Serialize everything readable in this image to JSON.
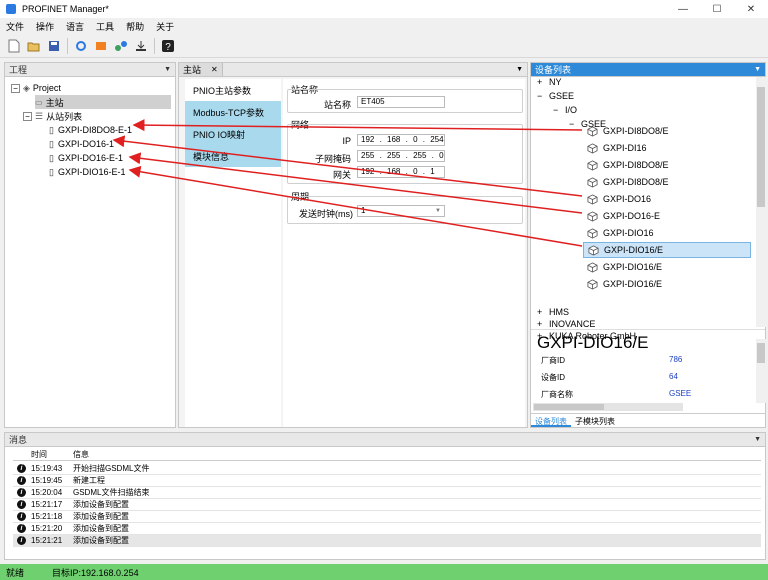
{
  "window": {
    "title": "PROFINET Manager*",
    "controls": [
      "—",
      "☐",
      "✕"
    ]
  },
  "menu": [
    "文件",
    "操作",
    "语言",
    "工具",
    "帮助",
    "关于"
  ],
  "project_panel": {
    "title": "工程",
    "root": "Project",
    "master": "主站",
    "slave_list": "从站列表",
    "slaves": [
      "GXPI-DI8DO8-E-1",
      "GXPI-DO16-1",
      "GXPI-DO16-E-1",
      "GXPI-DIO16-E-1"
    ]
  },
  "center_panel": {
    "tab_label": "主站",
    "side_tabs": [
      "PNIO主站参数",
      "Modbus-TCP参数",
      "PNIO IO映射",
      "模块信息"
    ],
    "station": {
      "group": "站名称",
      "label": "站名称",
      "value": "ET405"
    },
    "network": {
      "group": "网络",
      "ip_label": "IP",
      "ip": [
        "192",
        "168",
        "0",
        "254"
      ],
      "mask_label": "子网掩码",
      "mask": [
        "255",
        "255",
        "255",
        "0"
      ],
      "gw_label": "网关",
      "gw": [
        "192",
        "168",
        "0",
        "1"
      ]
    },
    "cycle": {
      "group": "周期",
      "label": "发送时钟(ms)",
      "value": "1"
    }
  },
  "device_panel": {
    "title": "设备列表",
    "vendors_top": [
      "NY",
      "GSEE"
    ],
    "io_label": "I/O",
    "gsee_label": "GSEE",
    "devices": [
      "GXPI-DI8DO8/E",
      "GXPI-DI16",
      "GXPI-DI8DO8/E",
      "GXPI-DI8DO8/E",
      "GXPI-DO16",
      "GXPI-DO16-E",
      "GXPI-DIO16",
      "GXPI-DIO16/E",
      "GXPI-DIO16/E",
      "GXPI-DIO16/E"
    ],
    "selected_index": 7,
    "vendors_bottom": [
      "HMS",
      "INOVANCE",
      "KUKA Roboter GmbH"
    ],
    "detail": {
      "name": "GXPI-DIO16/E",
      "rows": [
        {
          "label": "厂商ID",
          "value": "786"
        },
        {
          "label": "设备ID",
          "value": "64"
        },
        {
          "label": "厂商名称",
          "value": "GSEE"
        }
      ]
    },
    "bottom_tabs": [
      "设备列表",
      "子模块列表"
    ]
  },
  "messages": {
    "title": "消息",
    "col_time": "时间",
    "col_info": "信息",
    "rows": [
      {
        "time": "15:19:43",
        "text": "开始扫描GSDML文件"
      },
      {
        "time": "15:19:45",
        "text": "新建工程"
      },
      {
        "time": "15:20:04",
        "text": "GSDML文件扫描结束"
      },
      {
        "time": "15:21:17",
        "text": "添加设备到配置"
      },
      {
        "time": "15:21:18",
        "text": "添加设备到配置"
      },
      {
        "time": "15:21:20",
        "text": "添加设备到配置"
      },
      {
        "time": "15:21:21",
        "text": "添加设备到配置"
      }
    ]
  },
  "status": {
    "left": "就绪",
    "target": "目标IP:192.168.0.254"
  },
  "colors": {
    "accent": "#2e8ad8",
    "status_bar": "#6ed06e",
    "arrow": "#e02020",
    "tab_blue": "#a9d9ec"
  }
}
